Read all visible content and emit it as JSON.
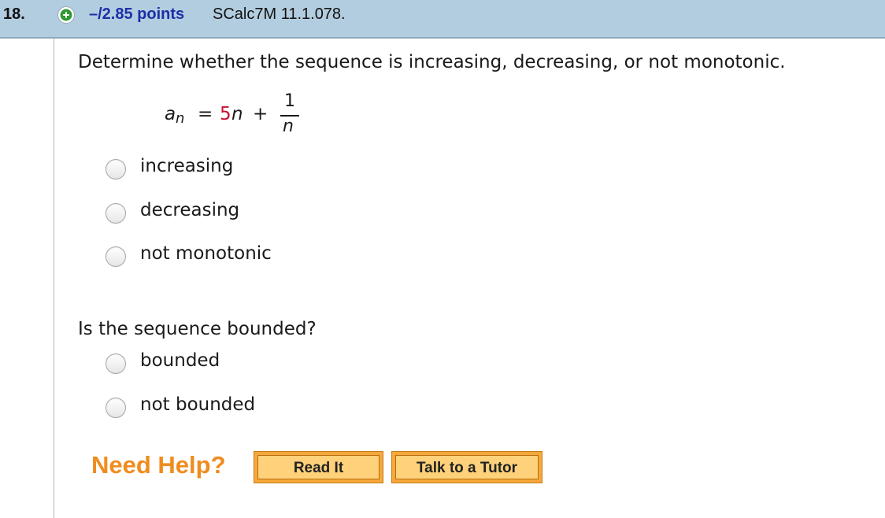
{
  "header": {
    "question_number": "18.",
    "points": "–/2.85 points",
    "source": "SCalc7M 11.1.078."
  },
  "question1": {
    "prompt": "Determine whether the sequence is increasing, decreasing, or not monotonic.",
    "formula": {
      "a": "a",
      "subscript": "n",
      "equals": "=",
      "coefficient": "5",
      "variable": "n",
      "plus": "+",
      "numerator": "1",
      "denominator": "n"
    },
    "options": [
      "increasing",
      "decreasing",
      "not monotonic"
    ]
  },
  "question2": {
    "prompt": "Is the sequence bounded?",
    "options": [
      "bounded",
      "not bounded"
    ]
  },
  "help": {
    "label": "Need Help?",
    "read_it": "Read It",
    "talk_to_tutor": "Talk to a Tutor"
  },
  "colors": {
    "header_bg": "#b3cde0",
    "points_blue": "#1c2fa6",
    "coefficient_red": "#c8102e",
    "need_help_orange": "#f08c1f"
  },
  "icons": {
    "expand": "plus-circle-icon"
  }
}
